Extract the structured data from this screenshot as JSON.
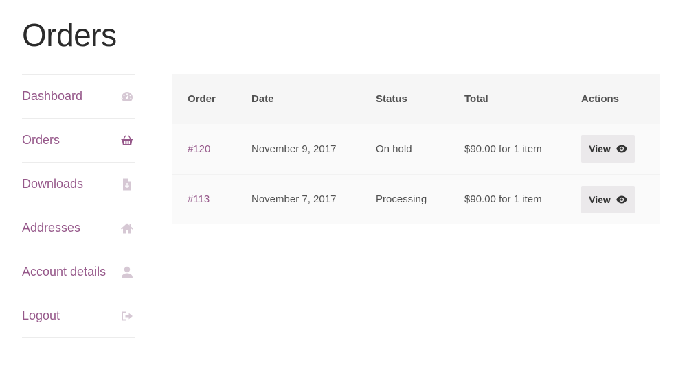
{
  "page": {
    "title": "Orders"
  },
  "colors": {
    "accent": "#96588a",
    "icon": "#d6c8d4",
    "icon_active": "#96588a"
  },
  "sidebar": {
    "items": [
      {
        "label": "Dashboard",
        "icon": "dashboard-icon",
        "active": false
      },
      {
        "label": "Orders",
        "icon": "basket-icon",
        "active": true
      },
      {
        "label": "Downloads",
        "icon": "file-download-icon",
        "active": false
      },
      {
        "label": "Addresses",
        "icon": "home-icon",
        "active": false
      },
      {
        "label": "Account details",
        "icon": "user-icon",
        "active": false
      },
      {
        "label": "Logout",
        "icon": "sign-out-icon",
        "active": false
      }
    ]
  },
  "table": {
    "headers": {
      "order": "Order",
      "date": "Date",
      "status": "Status",
      "total": "Total",
      "actions": "Actions"
    },
    "rows": [
      {
        "order": "#120",
        "date": "November 9, 2017",
        "status": "On hold",
        "total": "$90.00 for 1 item",
        "action": "View"
      },
      {
        "order": "#113",
        "date": "November 7, 2017",
        "status": "Processing",
        "total": "$90.00 for 1 item",
        "action": "View"
      }
    ]
  }
}
